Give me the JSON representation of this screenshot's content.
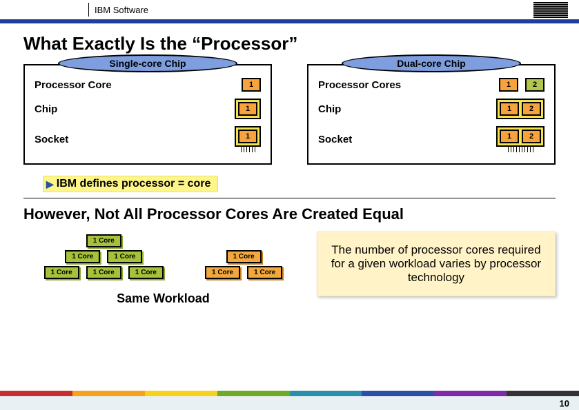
{
  "header": {
    "brand": "IBM Software"
  },
  "title": "What Exactly Is the “Processor”",
  "panels": {
    "left": {
      "caption": "Single-core Chip",
      "rows": {
        "core_label": "Processor Core",
        "chip_label": "Chip",
        "socket_label": "Socket"
      },
      "nums": {
        "one": "1"
      }
    },
    "right": {
      "caption": "Dual-core Chip",
      "rows": {
        "core_label": "Processor Cores",
        "chip_label": "Chip",
        "socket_label": "Socket"
      },
      "nums": {
        "one": "1",
        "two": "2"
      }
    }
  },
  "definition": "IBM defines processor = core",
  "subtitle": "However, Not All Processor Cores Are Created Equal",
  "cores": {
    "g1": "1 Core",
    "g2": "1 Core",
    "g3": "1 Core",
    "g4": "1 Core",
    "g5": "1 Core",
    "g6": "1 Core",
    "o1": "1 Core",
    "o2": "1 Core",
    "o3": "1 Core"
  },
  "same_workload": "Same Workload",
  "callout": "The number of processor cores required for a given workload varies by processor technology",
  "page_number": "10",
  "stripe_colors": [
    "#c62f2f",
    "#f6a21b",
    "#f6d21b",
    "#6fa92a",
    "#2a8fa9",
    "#2a4fa9",
    "#7e2aa9",
    "#333333"
  ]
}
